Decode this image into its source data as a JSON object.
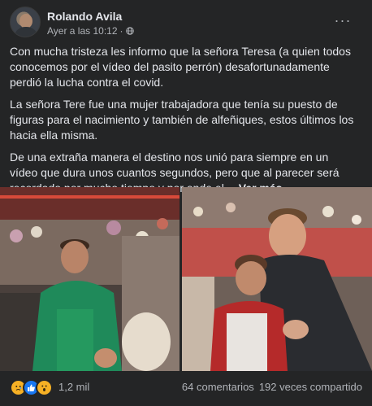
{
  "post": {
    "author": "Rolando Avila",
    "timestamp": "Ayer a las 10:12",
    "separator": "·",
    "paragraphs": [
      "Con mucha tristeza les informo que la señora Teresa (a quien todos conocemos por el vídeo del pasito perrón) desafortunadamente perdió la lucha contra el covid.",
      "La señora Tere fue una mujer trabajadora que tenía su puesto de figuras para el nacimiento y también de alfeñiques, estos últimos los hacia ella misma.",
      "De una extraña manera el destino nos unió para siempre en un vídeo que dura unos cuantos segundos, pero que al parecer será recordado por mucho tiempo y por ende el…"
    ],
    "see_more": "Ver más",
    "reactions_count": "1,2 mil",
    "comments": "64 comentarios",
    "shares": "192 veces compartido",
    "more_menu": "···",
    "reaction_icons": [
      "sad-icon",
      "like-icon",
      "wow-icon"
    ]
  },
  "colors": {
    "background": "#18191a",
    "card": "#242526",
    "text": "#e4e6eb",
    "secondary_text": "#b0b3b8",
    "like_blue": "#1877f2",
    "reaction_yellow": "#f7b125"
  }
}
